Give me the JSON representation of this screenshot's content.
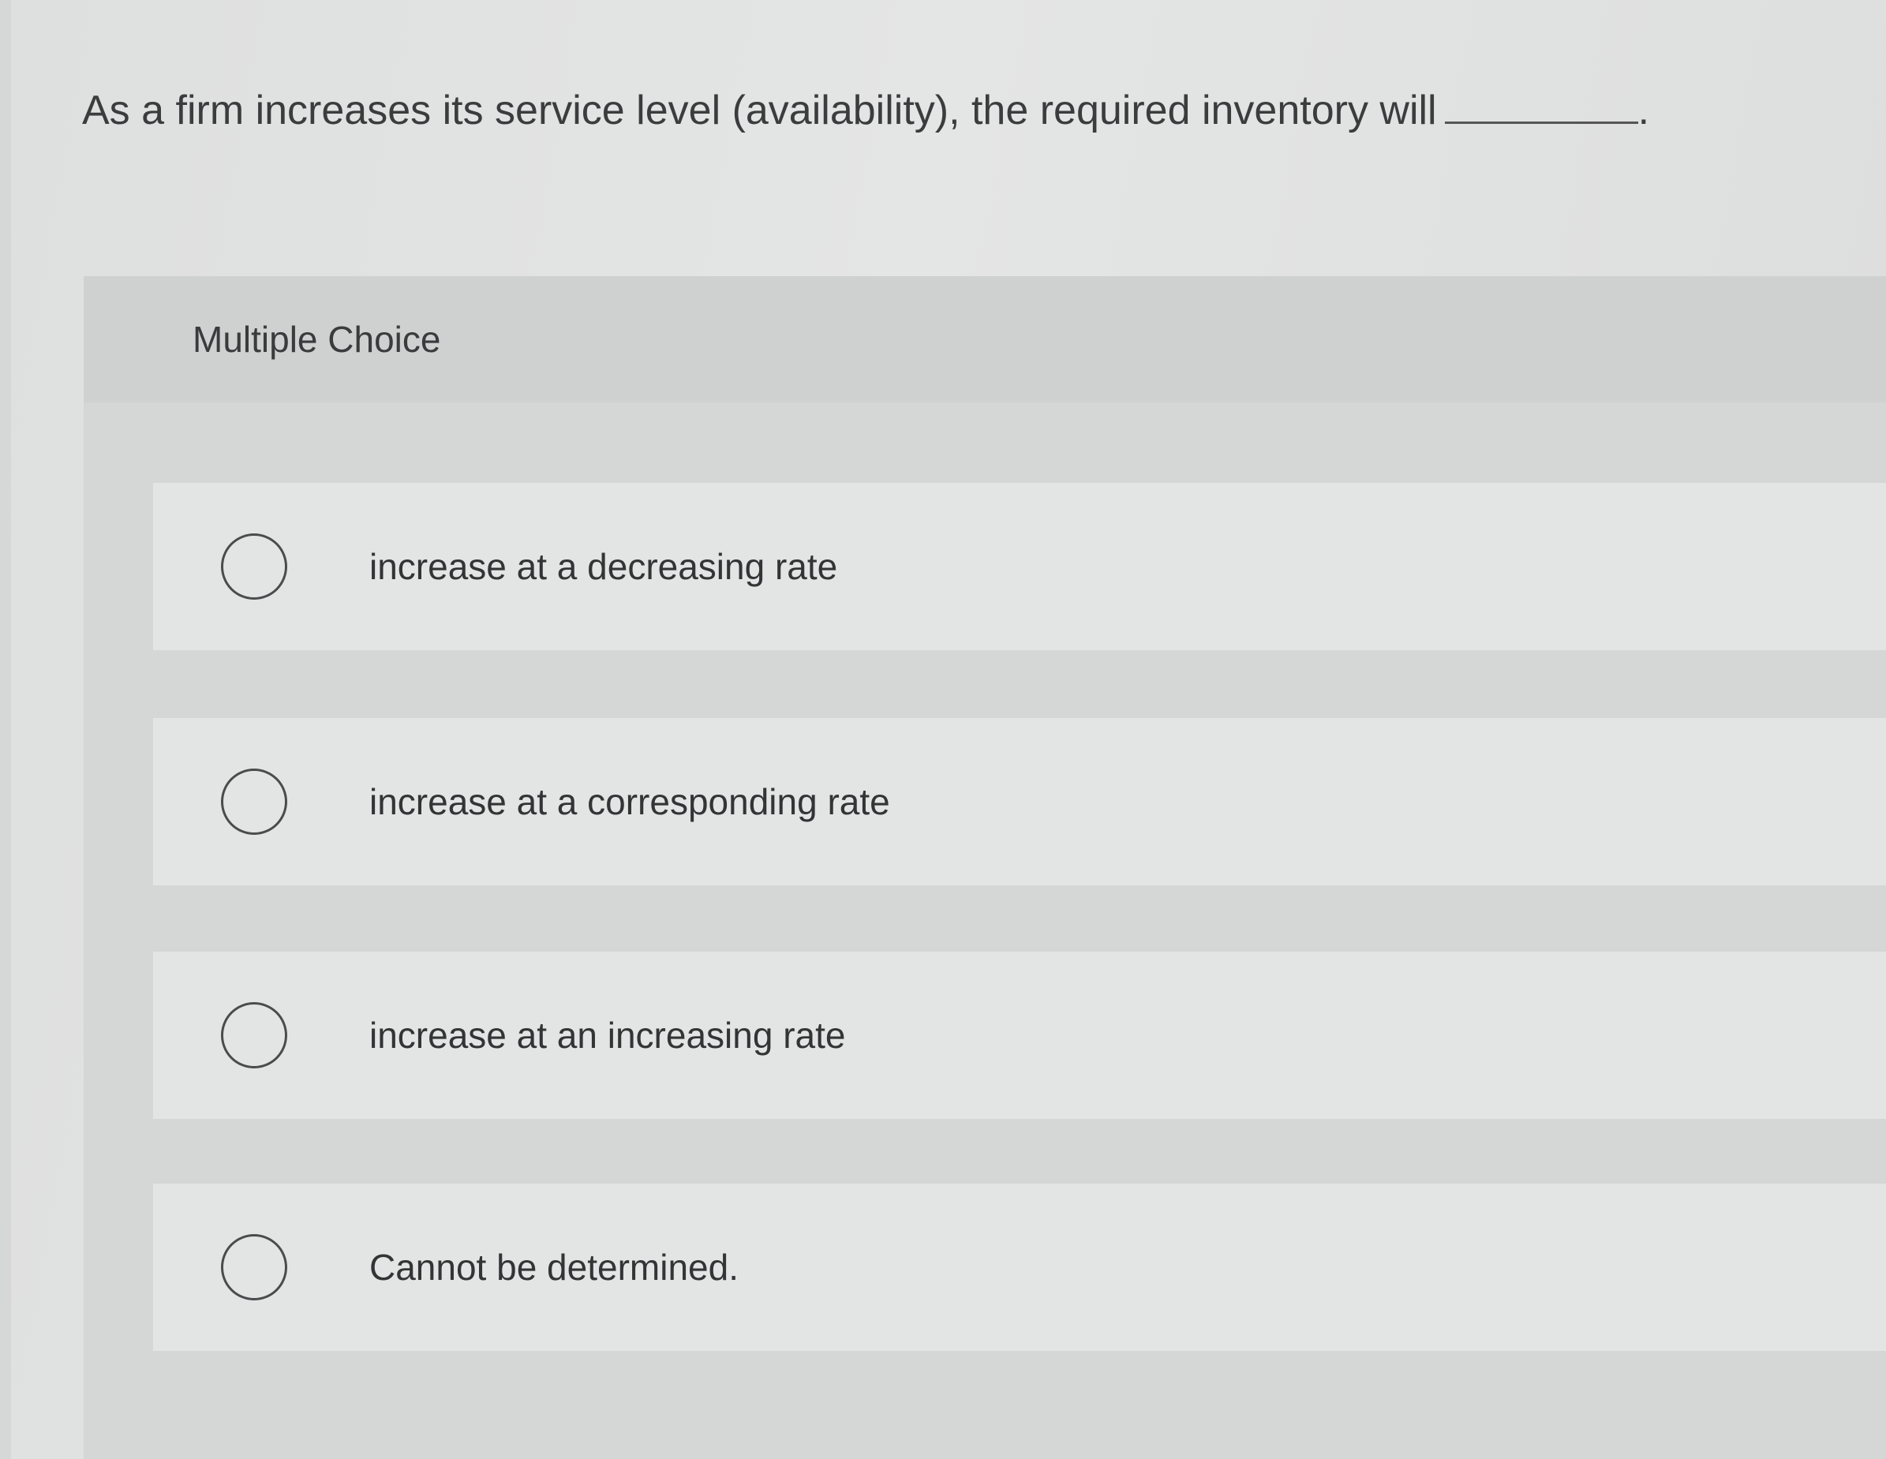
{
  "question": {
    "text": "As a firm increases its service level (availability), the required inventory will",
    "ending": "."
  },
  "multiple_choice": {
    "title": "Multiple Choice",
    "options": [
      {
        "label": "increase at a decreasing rate",
        "selected": false
      },
      {
        "label": "increase at a corresponding rate",
        "selected": false
      },
      {
        "label": "increase at an increasing rate",
        "selected": false
      },
      {
        "label": "Cannot be determined.",
        "selected": false
      }
    ]
  }
}
